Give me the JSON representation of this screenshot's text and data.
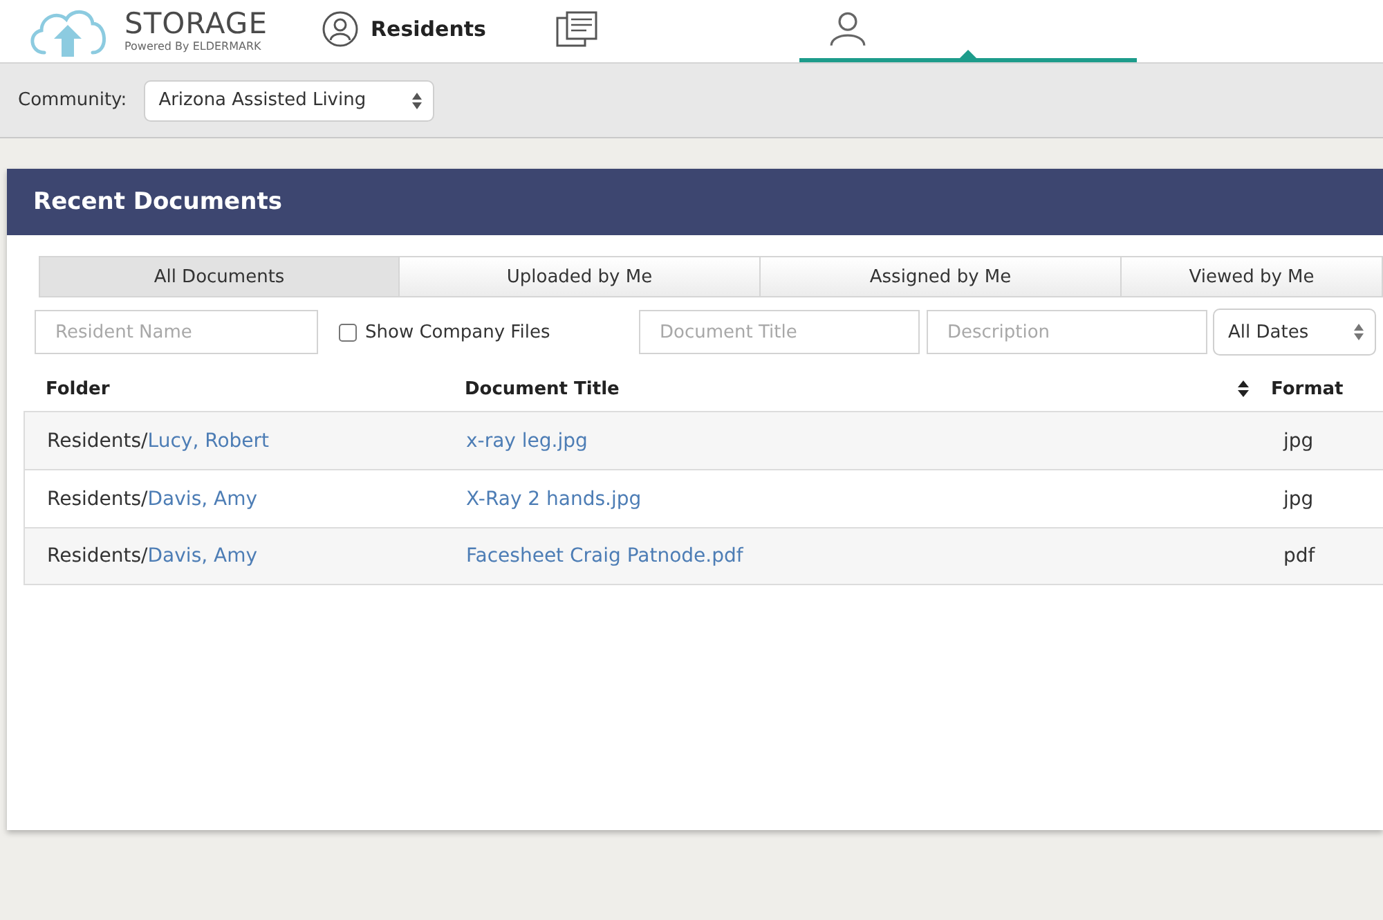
{
  "header": {
    "logo": {
      "title": "STORAGE",
      "tagline": "Powered By ELDERMARK"
    },
    "nav": [
      {
        "label": "Residents",
        "selected": false
      },
      {
        "selected": false
      },
      {
        "selected": true
      }
    ]
  },
  "community": {
    "label": "Community:",
    "value": "Arizona Assisted Living"
  },
  "panel": {
    "title": "Recent Documents",
    "tabs": [
      {
        "label": "All Documents",
        "selected": true
      },
      {
        "label": "Uploaded by Me",
        "selected": false
      },
      {
        "label": "Assigned by Me",
        "selected": false
      },
      {
        "label": "Viewed by Me",
        "selected": false
      }
    ],
    "filters": {
      "resident": {
        "placeholder": "Resident Name"
      },
      "company_files": {
        "label": "Show Company Files",
        "checked": false
      },
      "title": {
        "placeholder": "Document Title"
      },
      "description": {
        "placeholder": "Description"
      },
      "dates": {
        "value": "All Dates"
      }
    },
    "table": {
      "columns": [
        {
          "label": "Folder",
          "sortable": false
        },
        {
          "label": "Document Title",
          "sortable": false
        },
        {
          "label": "Format",
          "sortable": true
        }
      ],
      "rows": [
        {
          "folder": "Residents/",
          "resident": "Lucy, Robert",
          "title": "x-ray leg.jpg",
          "format": "jpg"
        },
        {
          "folder": "Residents/",
          "resident": "Davis, Amy",
          "title": "X-Ray 2 hands.jpg",
          "format": "jpg"
        },
        {
          "folder": "Residents/",
          "resident": "Davis, Amy",
          "title": "Facesheet Craig Patnode.pdf",
          "format": "pdf"
        }
      ]
    }
  }
}
